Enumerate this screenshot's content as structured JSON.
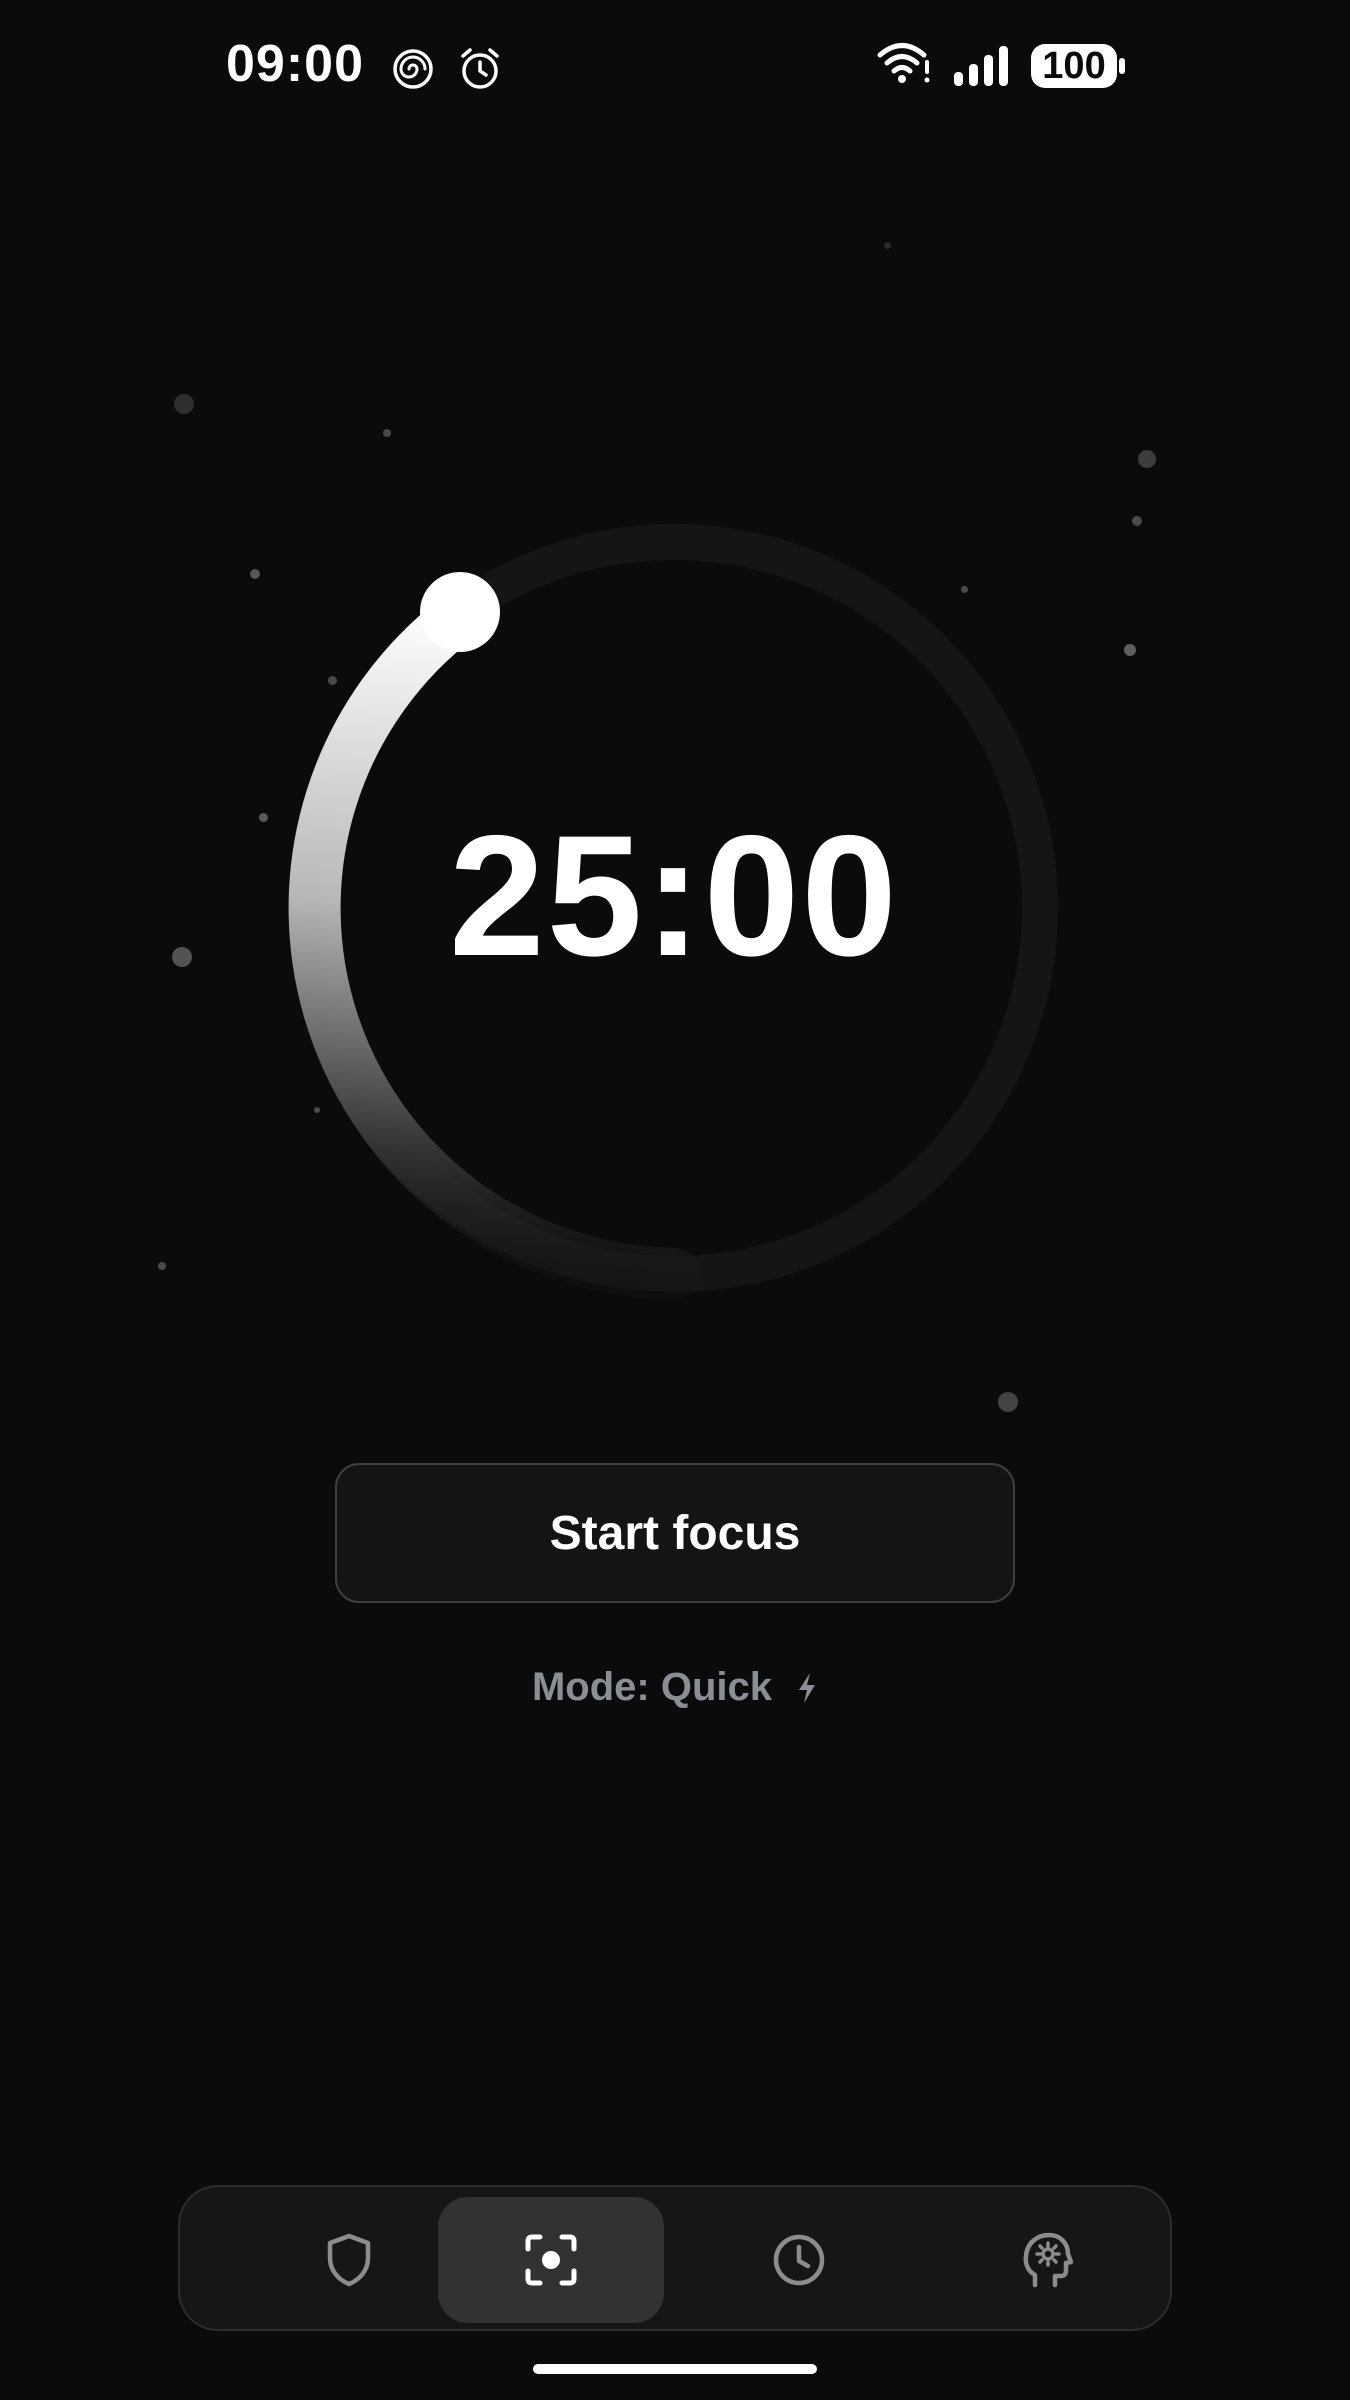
{
  "status_bar": {
    "time": "09:00",
    "battery_level": "100",
    "icons": [
      "focus-spiral-icon",
      "alarm-icon",
      "wifi-icon",
      "cellular-signal-icon",
      "battery-icon"
    ]
  },
  "timer": {
    "display": "25:00",
    "progress_color": "#ffffff",
    "track_color": "#151515"
  },
  "actions": {
    "start_label": "Start focus"
  },
  "mode": {
    "label": "Mode: Quick",
    "icon": "lightning-bolt-icon"
  },
  "bottom_nav": {
    "items": [
      {
        "icon": "shield-icon",
        "active": false
      },
      {
        "icon": "focus-target-icon",
        "active": true
      },
      {
        "icon": "clock-icon",
        "active": false
      },
      {
        "icon": "mind-gear-icon",
        "active": false
      }
    ]
  },
  "colors": {
    "background": "#0b0b0b",
    "button_bg": "#141414",
    "button_border": "#3f3f3f",
    "muted_text": "#8a8f96",
    "nav_bg": "#161616",
    "nav_active": "#323232"
  }
}
